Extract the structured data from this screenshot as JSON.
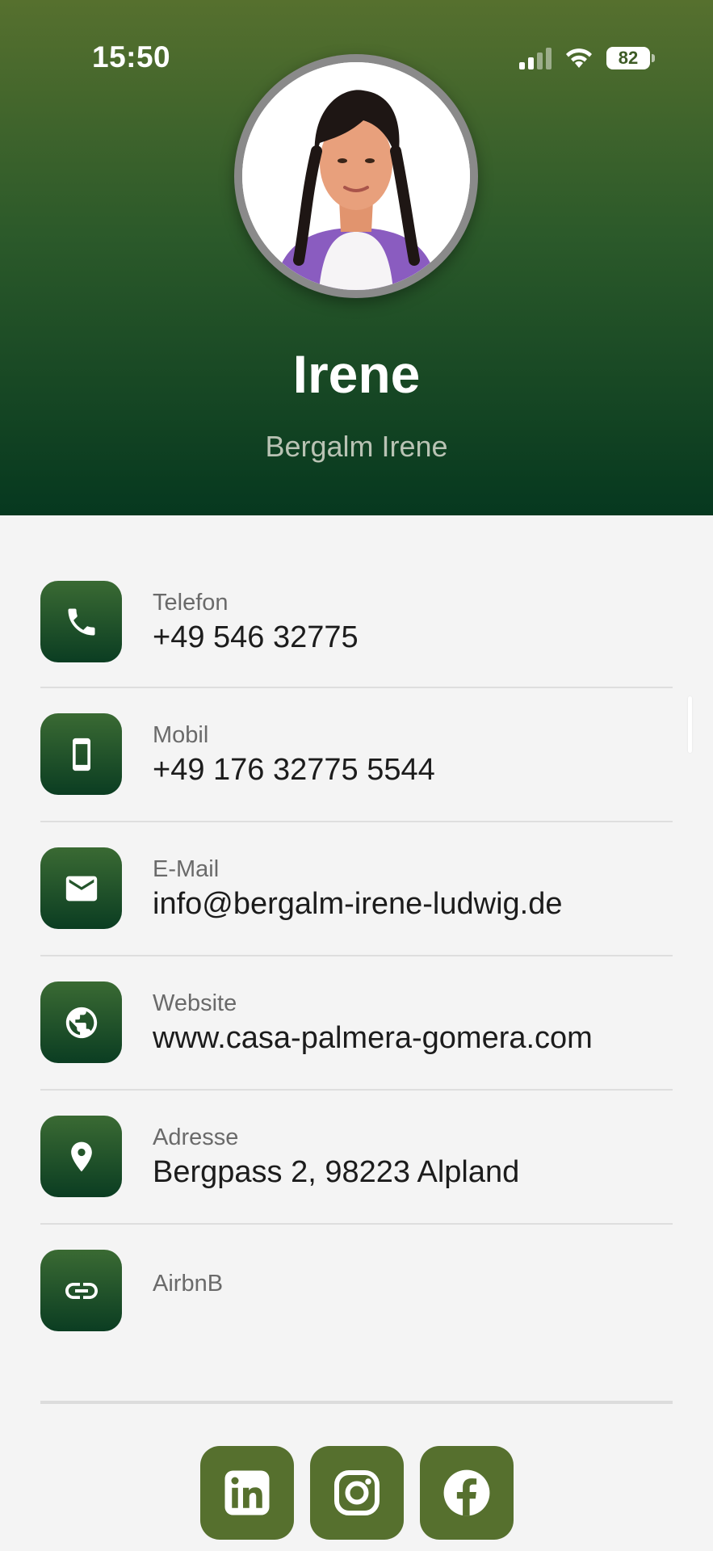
{
  "status_bar": {
    "time": "15:50",
    "battery": "82"
  },
  "profile": {
    "name": "Irene",
    "subtitle": "Bergalm Irene",
    "avatar_icon": "profile-photo"
  },
  "contacts": [
    {
      "label": "Telefon",
      "value": "+49 546 32775",
      "icon": "phone-icon"
    },
    {
      "label": "Mobil",
      "value": "+49 176 32775 5544",
      "icon": "mobile-phone-icon"
    },
    {
      "label": "E-Mail",
      "value": "info@bergalm-irene-ludwig.de",
      "icon": "mail-icon"
    },
    {
      "label": "Website",
      "value": "www.casa-palmera-gomera.com",
      "icon": "globe-icon"
    },
    {
      "label": "Adresse",
      "value": "Bergpass 2, 98223 Alpland",
      "icon": "location-pin-icon"
    },
    {
      "label": "AirbnB",
      "value": "",
      "icon": "link-icon"
    }
  ],
  "social": [
    {
      "name": "LinkedIn",
      "icon": "linkedin-icon"
    },
    {
      "name": "Instagram",
      "icon": "instagram-icon"
    },
    {
      "name": "Facebook",
      "icon": "facebook-icon"
    }
  ],
  "colors": {
    "header_top": "#56702e",
    "header_bottom": "#06381f",
    "icon_tile": "#1f5330",
    "social_tile": "#56702e",
    "background": "#f4f4f4"
  }
}
